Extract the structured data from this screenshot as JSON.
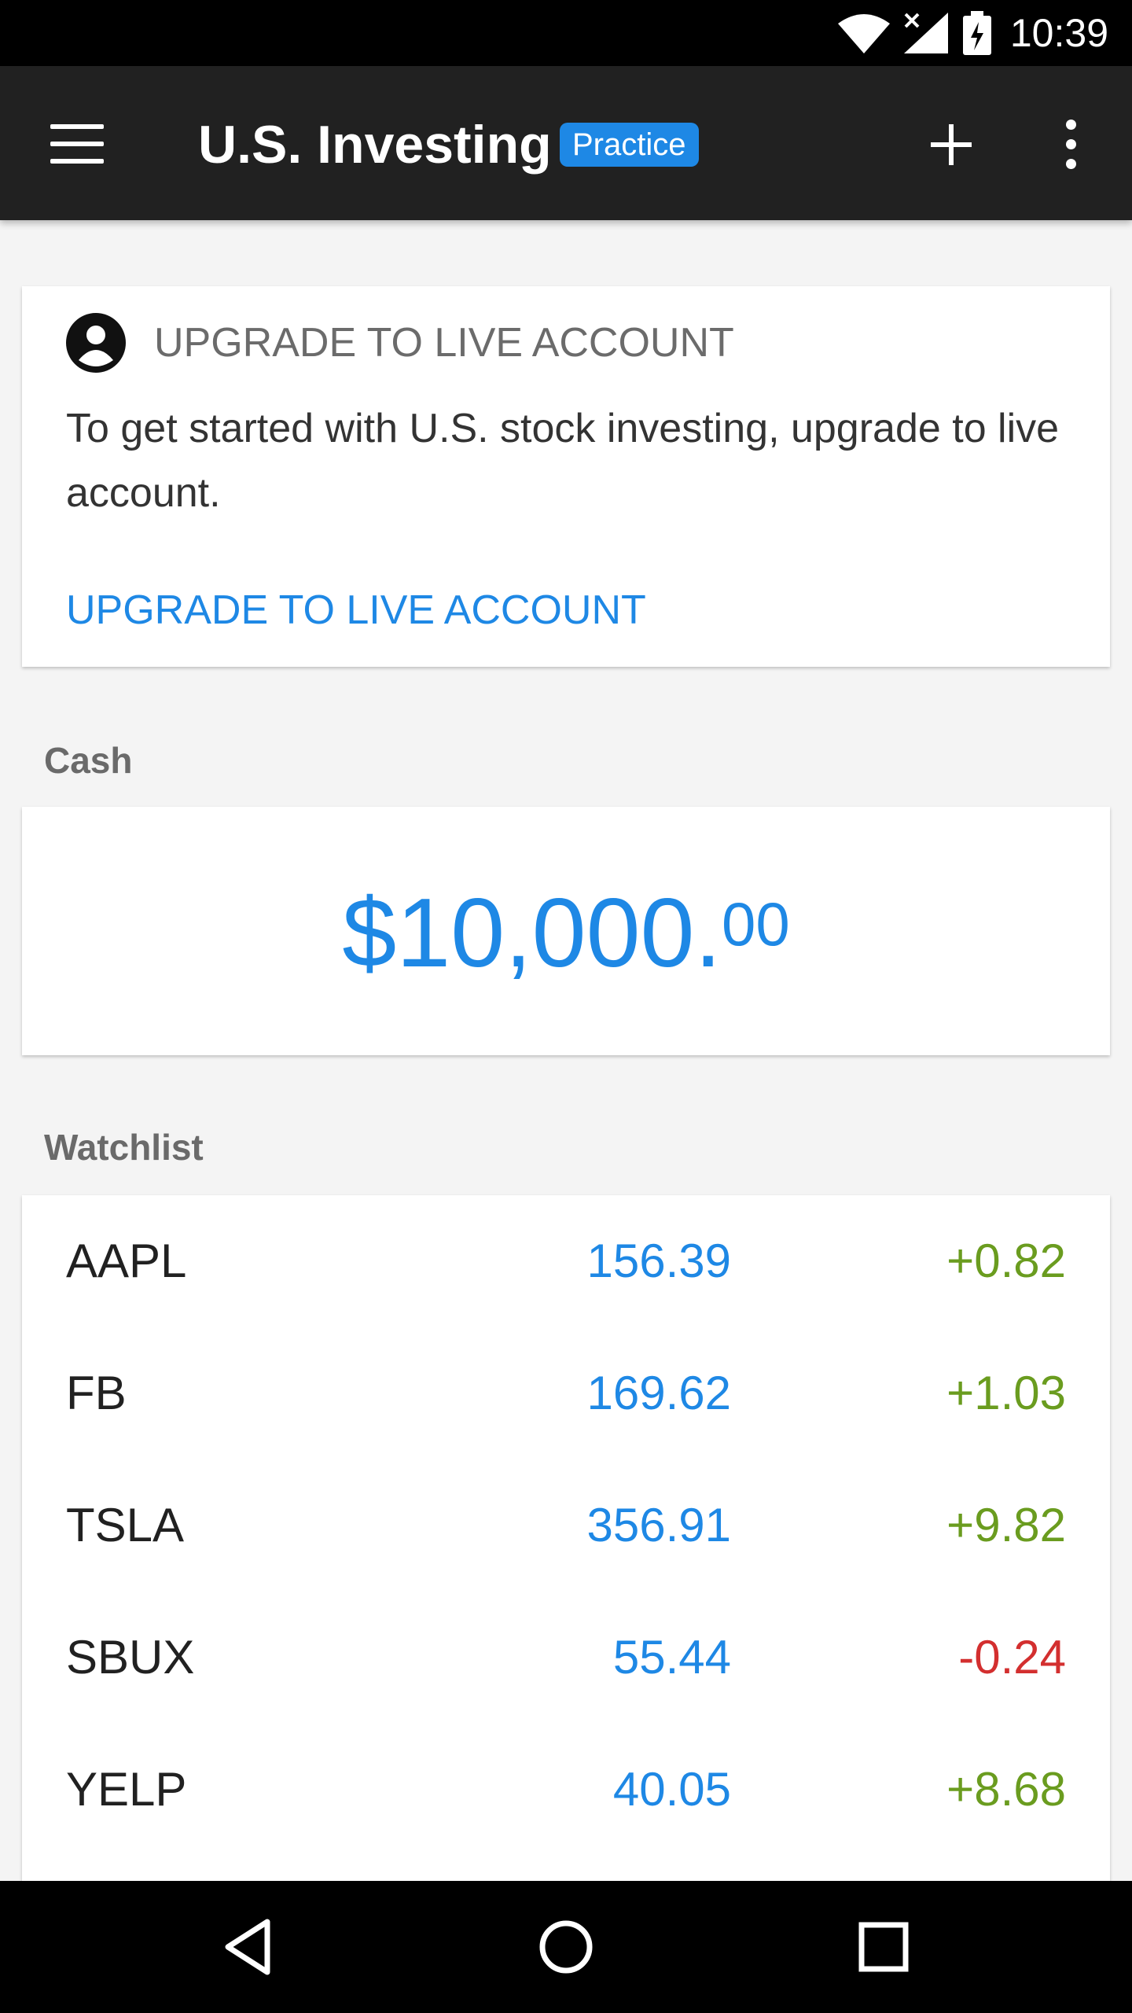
{
  "status_bar": {
    "time": "10:39"
  },
  "app_bar": {
    "title": "U.S. Investing",
    "badge": "Practice"
  },
  "upgrade_card": {
    "title": "UPGRADE TO LIVE ACCOUNT",
    "body": "To get started with U.S. stock investing, upgrade to live account.",
    "action": "UPGRADE TO LIVE ACCOUNT"
  },
  "cash": {
    "label": "Cash",
    "amount": "$10,000.",
    "cents": "00"
  },
  "watchlist": {
    "label": "Watchlist",
    "rows": [
      {
        "ticker": "AAPL",
        "price": "156.39",
        "change": "+0.82"
      },
      {
        "ticker": "FB",
        "price": "169.62",
        "change": "+1.03"
      },
      {
        "ticker": "TSLA",
        "price": "356.91",
        "change": "+9.82"
      },
      {
        "ticker": "SBUX",
        "price": "55.44",
        "change": "-0.24"
      },
      {
        "ticker": "YELP",
        "price": "40.05",
        "change": "+8.68"
      }
    ]
  },
  "colors": {
    "accent": "#1e88e5",
    "positive": "#6a9c1f",
    "negative": "#d32f2f",
    "app_bar": "#212121"
  }
}
